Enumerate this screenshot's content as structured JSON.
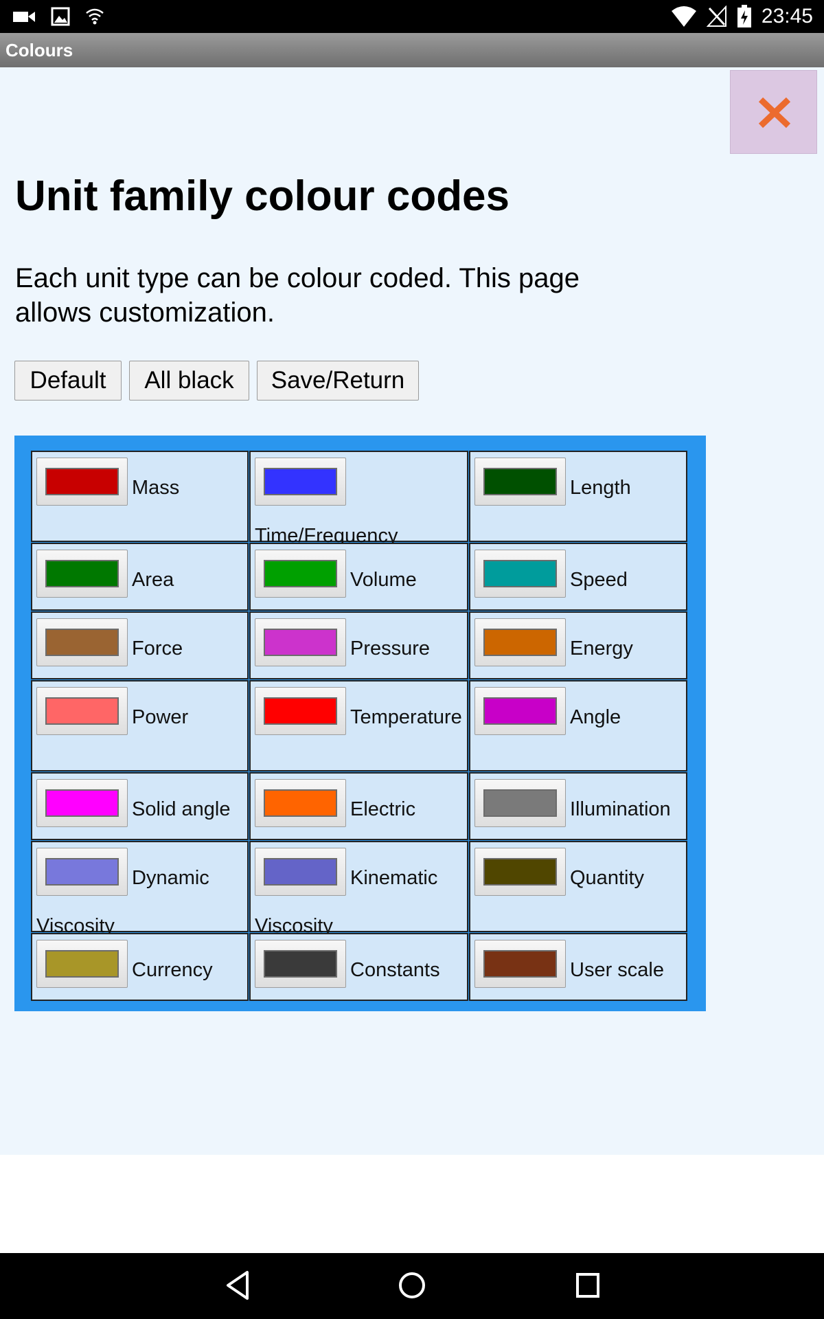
{
  "status_bar": {
    "time": "23:45",
    "left_icons": [
      "video-camera-icon",
      "image-icon",
      "wifi-signal-icon"
    ],
    "right_icons": [
      "wifi-icon",
      "no-signal-icon",
      "battery-charging-icon"
    ]
  },
  "title_bar": {
    "title": "Colours"
  },
  "main": {
    "heading": "Unit family colour codes",
    "description": "Each unit type can be colour coded. This page allows customization.",
    "buttons": {
      "default": "Default",
      "all_black": "All black",
      "save_return": "Save/Return"
    }
  },
  "colors": {
    "accent": "#2a96ee",
    "close_icon": "#ec6b2e",
    "page_background": "#eef6fd",
    "cell_background": "#d3e7f9"
  },
  "units": [
    [
      {
        "label": "Mass",
        "color": "#c80000"
      },
      {
        "label": "Time/Frequency",
        "color": "#3333ff"
      },
      {
        "label": "Length",
        "color": "#005000"
      }
    ],
    [
      {
        "label": "Area",
        "color": "#007800"
      },
      {
        "label": "Volume",
        "color": "#00a000"
      },
      {
        "label": "Speed",
        "color": "#009c9c"
      }
    ],
    [
      {
        "label": "Force",
        "color": "#9a6432"
      },
      {
        "label": "Pressure",
        "color": "#cc33cc"
      },
      {
        "label": "Energy",
        "color": "#cc6600"
      }
    ],
    [
      {
        "label": "Power",
        "color": "#ff6666"
      },
      {
        "label": "Temperature",
        "color": "#ff0000"
      },
      {
        "label": "Angle",
        "color": "#c800c8"
      }
    ],
    [
      {
        "label": "Solid angle",
        "color": "#ff00ff"
      },
      {
        "label": "Electric",
        "color": "#ff6400"
      },
      {
        "label": "Illumination",
        "color": "#7a7a7a"
      }
    ],
    [
      {
        "label": "Dynamic Viscosity",
        "color": "#7878dc"
      },
      {
        "label": "Kinematic Viscosity",
        "color": "#6464c8"
      },
      {
        "label": "Quantity",
        "color": "#504600"
      }
    ],
    [
      {
        "label": "Currency",
        "color": "#a89628"
      },
      {
        "label": "Constants",
        "color": "#3a3a3a"
      },
      {
        "label": "User scale",
        "color": "#783214"
      }
    ]
  ],
  "nav_bar": {
    "icons": [
      "back-icon",
      "home-icon",
      "recents-icon"
    ]
  }
}
